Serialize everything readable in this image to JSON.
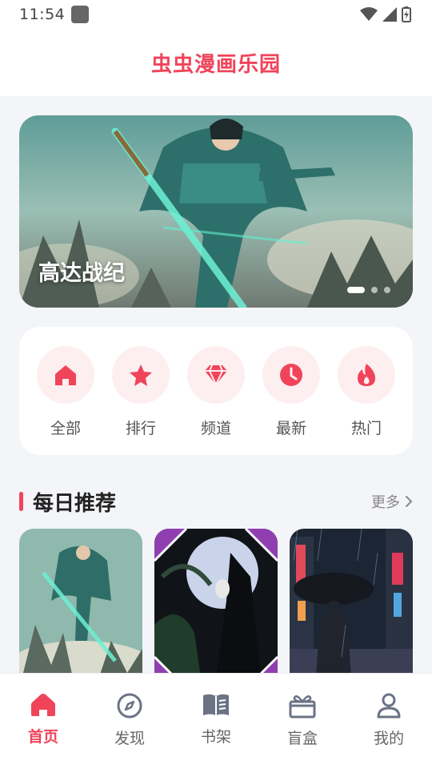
{
  "status_bar": {
    "time": "11:54",
    "icons": [
      "app-notification-icon",
      "wifi-icon",
      "signal-icon",
      "battery-charging-icon"
    ]
  },
  "header": {
    "title": "虫虫漫画乐园"
  },
  "banner": {
    "title": "高达战纪",
    "dots_total": 3,
    "dots_active": 1
  },
  "categories": [
    {
      "label": "全部",
      "icon": "home-icon"
    },
    {
      "label": "排行",
      "icon": "star-icon"
    },
    {
      "label": "频道",
      "icon": "diamond-icon"
    },
    {
      "label": "最新",
      "icon": "clock-icon"
    },
    {
      "label": "热门",
      "icon": "flame-icon"
    }
  ],
  "section": {
    "title": "每日推荐",
    "more_label": "更多"
  },
  "cards": [
    {
      "icon": "swordsman-cover-image"
    },
    {
      "icon": "masked-figure-cover-image"
    },
    {
      "icon": "rainy-city-cover-image"
    }
  ],
  "bottom_nav": [
    {
      "label": "首页",
      "icon": "home-icon",
      "active": true
    },
    {
      "label": "发现",
      "icon": "compass-icon",
      "active": false
    },
    {
      "label": "书架",
      "icon": "book-icon",
      "active": false
    },
    {
      "label": "盲盒",
      "icon": "gift-box-icon",
      "active": false
    },
    {
      "label": "我的",
      "icon": "user-icon",
      "active": false
    }
  ],
  "colors": {
    "accent": "#f0445a",
    "accent_soft": "#fdeef0",
    "background": "#f4f5f8"
  }
}
